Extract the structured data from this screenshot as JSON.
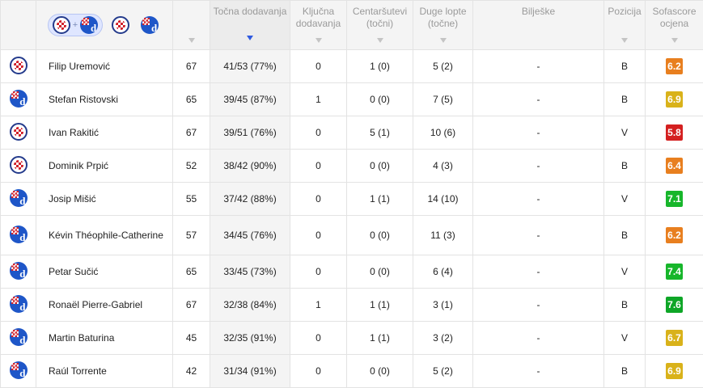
{
  "filters": {
    "combined_label": "+",
    "teams": [
      "hajduk",
      "dinamo"
    ]
  },
  "columns": {
    "apps": "",
    "accurate_passes": "Točna dodavanja",
    "key_passes": "Ključna dodavanja",
    "crosses": "Centaršutevi (točni)",
    "long_balls": "Duge lopte (točne)",
    "notes": "Bilješke",
    "position": "Pozicija",
    "rating": "Sofascore ocjena"
  },
  "rating_colors": {
    "orange": "#e87f1f",
    "yellow": "#d9b21a",
    "red": "#d42020",
    "green": "#17b62b",
    "green_dark": "#0ea627"
  },
  "players": [
    {
      "team": "hajduk",
      "name": "Filip Uremović",
      "minutes": "67",
      "passes": "41/53 (77%)",
      "key": "0",
      "crosses": "1 (0)",
      "long": "5 (2)",
      "notes": "-",
      "pos": "B",
      "rating": "6.2",
      "rating_color": "#e87f1f"
    },
    {
      "team": "dinamo",
      "name": "Stefan Ristovski",
      "minutes": "65",
      "passes": "39/45 (87%)",
      "key": "1",
      "crosses": "0 (0)",
      "long": "7 (5)",
      "notes": "-",
      "pos": "B",
      "rating": "6.9",
      "rating_color": "#d9b21a"
    },
    {
      "team": "hajduk",
      "name": "Ivan Rakitić",
      "minutes": "67",
      "passes": "39/51 (76%)",
      "key": "0",
      "crosses": "5 (1)",
      "long": "10 (6)",
      "notes": "-",
      "pos": "V",
      "rating": "5.8",
      "rating_color": "#d42020"
    },
    {
      "team": "hajduk",
      "name": "Dominik Prpić",
      "minutes": "52",
      "passes": "38/42 (90%)",
      "key": "0",
      "crosses": "0 (0)",
      "long": "4 (3)",
      "notes": "-",
      "pos": "B",
      "rating": "6.4",
      "rating_color": "#e87f1f"
    },
    {
      "team": "dinamo",
      "name": "Josip Mišić",
      "minutes": "55",
      "passes": "37/42 (88%)",
      "key": "0",
      "crosses": "1 (1)",
      "long": "14 (10)",
      "notes": "-",
      "pos": "V",
      "rating": "7.1",
      "rating_color": "#17b62b"
    },
    {
      "team": "dinamo",
      "name": "Kévin Théophile-Catherine",
      "minutes": "57",
      "passes": "34/45 (76%)",
      "key": "0",
      "crosses": "0 (0)",
      "long": "11 (3)",
      "notes": "-",
      "pos": "B",
      "rating": "6.2",
      "rating_color": "#e87f1f"
    },
    {
      "team": "dinamo",
      "name": "Petar Sučić",
      "minutes": "65",
      "passes": "33/45 (73%)",
      "key": "0",
      "crosses": "0 (0)",
      "long": "6 (4)",
      "notes": "-",
      "pos": "V",
      "rating": "7.4",
      "rating_color": "#17b62b"
    },
    {
      "team": "dinamo",
      "name": "Ronaël Pierre-Gabriel",
      "minutes": "67",
      "passes": "32/38 (84%)",
      "key": "1",
      "crosses": "1 (1)",
      "long": "3 (1)",
      "notes": "-",
      "pos": "B",
      "rating": "7.6",
      "rating_color": "#0ea627"
    },
    {
      "team": "dinamo",
      "name": "Martin Baturina",
      "minutes": "45",
      "passes": "32/35 (91%)",
      "key": "0",
      "crosses": "1 (1)",
      "long": "3 (2)",
      "notes": "-",
      "pos": "V",
      "rating": "6.7",
      "rating_color": "#d9b21a"
    },
    {
      "team": "dinamo",
      "name": "Raúl Torrente",
      "minutes": "42",
      "passes": "31/34 (91%)",
      "key": "0",
      "crosses": "0 (0)",
      "long": "5 (2)",
      "notes": "-",
      "pos": "B",
      "rating": "6.9",
      "rating_color": "#d9b21a"
    }
  ]
}
